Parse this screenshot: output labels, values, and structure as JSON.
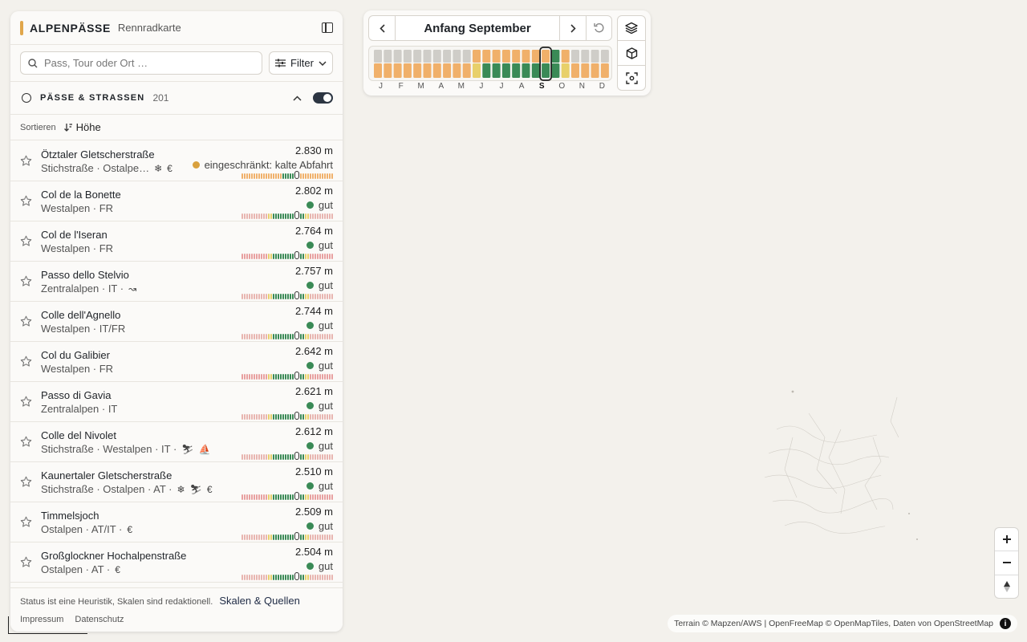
{
  "app": {
    "brand": "ALPENPÄSSE",
    "subtitle": "Rennradkarte"
  },
  "search": {
    "placeholder": "Pass, Tour oder Ort …",
    "filter_label": "Filter"
  },
  "section": {
    "title": "PÄSSE & STRASSEN",
    "count": "201",
    "toggle_on": true
  },
  "sort": {
    "label": "Sortieren",
    "value": "Höhe"
  },
  "timeline": {
    "title": "Anfang September",
    "months": [
      "J",
      "F",
      "M",
      "A",
      "M",
      "J",
      "J",
      "A",
      "S",
      "O",
      "N",
      "D"
    ],
    "current_month_index": 8
  },
  "passes": [
    {
      "name": "Ötztaler Gletscherstraße",
      "meta": "Stichstraße · Ostalpe…",
      "icons": [
        "snowflake",
        "euro"
      ],
      "elevation": "2.830 m",
      "status": "eingeschränkt: kalte Abfahrt",
      "status_color": "#d9a13e"
    },
    {
      "name": "Col de la Bonette",
      "meta": "Westalpen · FR",
      "icons": [],
      "elevation": "2.802 m",
      "status": "gut",
      "status_color": "#3a8a56"
    },
    {
      "name": "Col de l'Iseran",
      "meta": "Westalpen · FR",
      "icons": [],
      "elevation": "2.764 m",
      "status": "gut",
      "status_color": "#3a8a56"
    },
    {
      "name": "Passo dello Stelvio",
      "meta": "Zentralalpen · IT ·",
      "icons": [
        "serpentine"
      ],
      "elevation": "2.757 m",
      "status": "gut",
      "status_color": "#3a8a56"
    },
    {
      "name": "Colle dell'Agnello",
      "meta": "Westalpen · IT/FR",
      "icons": [],
      "elevation": "2.744 m",
      "status": "gut",
      "status_color": "#3a8a56"
    },
    {
      "name": "Col du Galibier",
      "meta": "Westalpen · FR",
      "icons": [],
      "elevation": "2.642 m",
      "status": "gut",
      "status_color": "#3a8a56"
    },
    {
      "name": "Passo di Gavia",
      "meta": "Zentralalpen · IT",
      "icons": [],
      "elevation": "2.621 m",
      "status": "gut",
      "status_color": "#3a8a56"
    },
    {
      "name": "Colle del Nivolet",
      "meta": "Stichstraße · Westalpen · IT ·",
      "icons": [
        "ski-lift",
        "boat"
      ],
      "elevation": "2.612 m",
      "status": "gut",
      "status_color": "#3a8a56"
    },
    {
      "name": "Kaunertaler Gletscherstraße",
      "meta": "Stichstraße · Ostalpen · AT ·",
      "icons": [
        "snowflake",
        "ski-lift",
        "euro"
      ],
      "elevation": "2.510 m",
      "status": "gut",
      "status_color": "#3a8a56"
    },
    {
      "name": "Timmelsjoch",
      "meta": "Ostalpen · AT/IT ·",
      "icons": [
        "euro"
      ],
      "elevation": "2.509 m",
      "status": "gut",
      "status_color": "#3a8a56"
    },
    {
      "name": "Großglockner Hochalpenstraße",
      "meta": "Ostalpen · AT ·",
      "icons": [
        "euro"
      ],
      "elevation": "2.504 m",
      "status": "gut",
      "status_color": "#3a8a56"
    }
  ],
  "footer": {
    "note": "Status ist eine Heuristik, Skalen sind redaktionell.",
    "link": "Skalen & Quellen",
    "impressum": "Impressum",
    "datenschutz": "Datenschutz"
  },
  "map": {
    "attribution": "Terrain © Mapzen/AWS | OpenFreeMap © OpenMapTiles, Daten von OpenStreetMap"
  },
  "colors": {
    "good": "#3a8a56",
    "limited": "#f0b06a",
    "closed": "#cfcdc8",
    "caution": "#e8d06a",
    "accent": "#e0a64a"
  }
}
